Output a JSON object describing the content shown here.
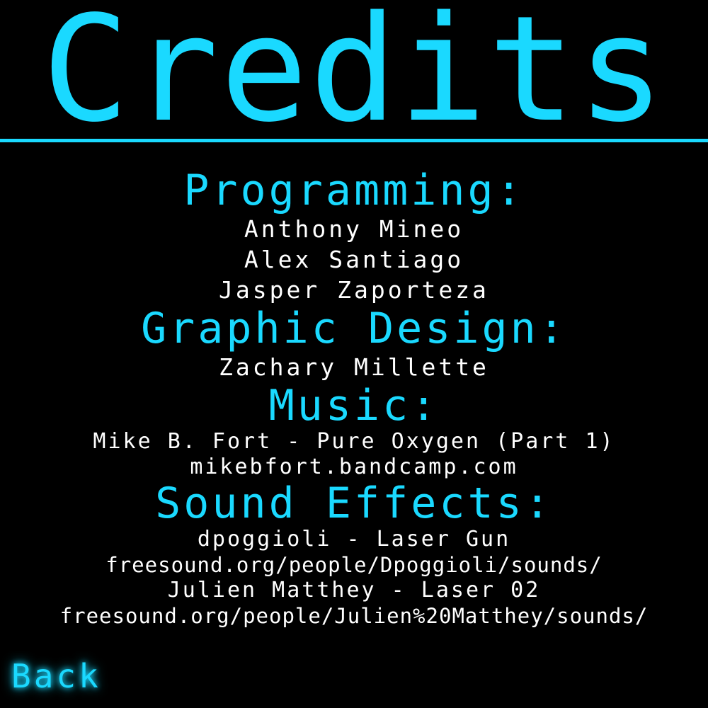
{
  "screen": {
    "title": "Credits",
    "accent_color": "#1ad9ff",
    "text_color": "#ffffff",
    "background_color": "#000000"
  },
  "sections": {
    "programming": {
      "heading": "Programming:",
      "lines": [
        "Anthony Mineo",
        "Alex Santiago",
        "Jasper Zaporteza"
      ]
    },
    "graphic_design": {
      "heading": "Graphic Design:",
      "lines": [
        "Zachary Millette"
      ]
    },
    "music": {
      "heading": "Music:",
      "lines": [
        "Mike B. Fort - Pure Oxygen (Part 1)",
        "mikebfort.bandcamp.com"
      ]
    },
    "sound_effects": {
      "heading": "Sound Effects:",
      "lines": [
        "dpoggioli - Laser Gun",
        "freesound.org/people/Dpoggioli/sounds/",
        "Julien Matthey - Laser 02",
        "freesound.org/people/Julien%20Matthey/sounds/"
      ]
    }
  },
  "back_button": {
    "label": "Back"
  }
}
